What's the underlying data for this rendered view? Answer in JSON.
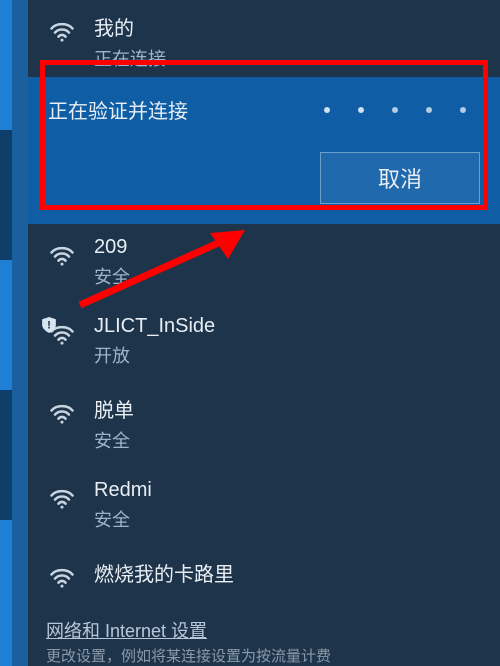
{
  "active": {
    "name": "我的",
    "connecting": "正在连接",
    "status": "正在验证并连接",
    "cancel": "取消"
  },
  "networks": [
    {
      "name": "209",
      "sub": "安全",
      "shield": false
    },
    {
      "name": "JLICT_InSide",
      "sub": "开放",
      "shield": true
    },
    {
      "name": "脱单",
      "sub": "安全",
      "shield": false
    },
    {
      "name": "Redmi",
      "sub": "安全",
      "shield": false
    },
    {
      "name": "燃烧我的卡路里",
      "sub": "",
      "shield": false
    }
  ],
  "footer": {
    "link": "网络和 Internet 设置",
    "sub": "更改设置，例如将某连接设置为按流量计费"
  }
}
